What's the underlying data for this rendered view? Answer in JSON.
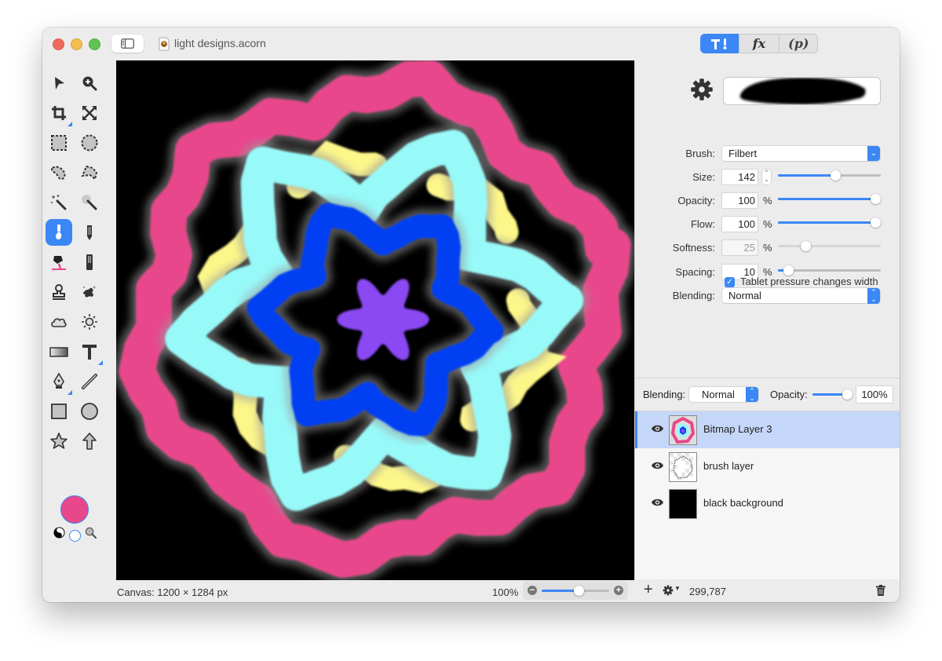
{
  "window": {
    "title": "light designs.acorn",
    "mode_tabs": [
      {
        "label": "T!",
        "icon": "tools-icon",
        "active": true
      },
      {
        "label": "fx",
        "icon": "fx-icon",
        "active": false
      },
      {
        "label": "(p)",
        "icon": "properties-icon",
        "active": false
      }
    ]
  },
  "toolbox": {
    "tools": [
      {
        "name": "move-tool",
        "icon": "arrow-cursor-icon"
      },
      {
        "name": "zoom-tool",
        "icon": "zoom-in-icon"
      },
      {
        "name": "crop-tool",
        "icon": "crop-icon"
      },
      {
        "name": "transform-tool",
        "icon": "resize-arrows-icon"
      },
      {
        "name": "rect-select-tool",
        "icon": "rect-marquee-icon"
      },
      {
        "name": "ellipse-select-tool",
        "icon": "ellipse-marquee-icon"
      },
      {
        "name": "lasso-tool",
        "icon": "lasso-icon"
      },
      {
        "name": "polygon-lasso-tool",
        "icon": "polygon-lasso-icon"
      },
      {
        "name": "magic-wand-tool",
        "icon": "magic-wand-icon"
      },
      {
        "name": "instant-alpha-tool",
        "icon": "instant-alpha-icon"
      },
      {
        "name": "brush-tool",
        "icon": "brush-icon",
        "active": true
      },
      {
        "name": "pencil-tool",
        "icon": "pencil-icon"
      },
      {
        "name": "paint-bucket-tool",
        "icon": "paint-bucket-icon"
      },
      {
        "name": "eraser-tool",
        "icon": "eraser-icon"
      },
      {
        "name": "clone-tool",
        "icon": "stamp-icon"
      },
      {
        "name": "smudge-tool",
        "icon": "splatter-icon"
      },
      {
        "name": "burn-tool",
        "icon": "cloud-icon"
      },
      {
        "name": "dodge-tool",
        "icon": "sun-icon"
      },
      {
        "name": "gradient-tool",
        "icon": "gradient-icon"
      },
      {
        "name": "text-tool",
        "icon": "text-icon"
      },
      {
        "name": "pen-tool",
        "icon": "pen-nib-icon"
      },
      {
        "name": "line-tool",
        "icon": "line-icon"
      },
      {
        "name": "rectangle-tool",
        "icon": "square-icon"
      },
      {
        "name": "oval-tool",
        "icon": "circle-icon"
      },
      {
        "name": "star-tool",
        "icon": "star-icon"
      },
      {
        "name": "arrow-tool",
        "icon": "up-arrow-icon"
      }
    ],
    "foreground_color": "#e8478b",
    "background_color": "#ffffff"
  },
  "canvas": {
    "info": "Canvas: 1200 × 1284 px",
    "zoom_label": "100%",
    "zoom_fraction": 0.55,
    "colors": {
      "background": "#000000",
      "pink": "#e8478b",
      "yellow": "#fdf78a",
      "cyan": "#98f9f9",
      "blue": "#0540f2",
      "purple": "#8a48f3"
    }
  },
  "inspector": {
    "brush_label": "Brush:",
    "brush_value": "Filbert",
    "size_label": "Size:",
    "size_value": "142",
    "size_fraction": 0.56,
    "opacity_label": "Opacity:",
    "opacity_value": "100",
    "opacity_fraction": 1.0,
    "flow_label": "Flow:",
    "flow_value": "100",
    "flow_fraction": 1.0,
    "softness_label": "Softness:",
    "softness_value": "25",
    "softness_fraction": 0.27,
    "spacing_label": "Spacing:",
    "spacing_value": "10",
    "spacing_fraction": 0.1,
    "percent": "%",
    "blending_label": "Blending:",
    "blending_value": "Normal",
    "tablet_checkbox_label": "Tablet pressure changes width",
    "tablet_checked": true
  },
  "layers": {
    "blending_label": "Blending:",
    "blending_value": "Normal",
    "opacity_label": "Opacity:",
    "opacity_value": "100%",
    "opacity_fraction": 1.0,
    "items": [
      {
        "name": "Bitmap Layer 3",
        "visible": true,
        "selected": true
      },
      {
        "name": "brush layer",
        "visible": true,
        "selected": false
      },
      {
        "name": "black background",
        "visible": true,
        "selected": false
      }
    ],
    "count_value": "299,787"
  }
}
